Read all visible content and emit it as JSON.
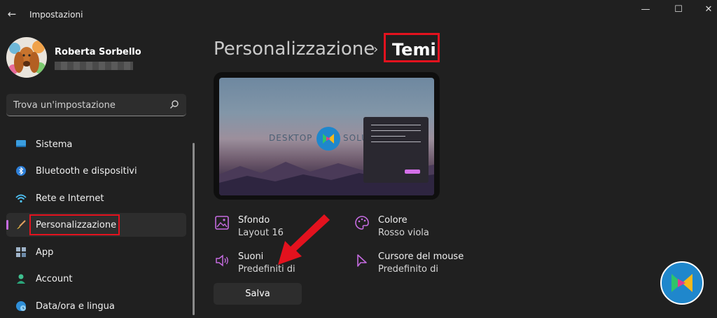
{
  "app": {
    "title": "Impostazioni"
  },
  "window_controls": {
    "minimize": "—",
    "maximize": "☐",
    "close": "✕"
  },
  "user": {
    "name": "Roberta Sorbello"
  },
  "search": {
    "placeholder": "Trova un'impostazione"
  },
  "sidebar": {
    "items": [
      {
        "label": "Sistema",
        "icon": "monitor-icon"
      },
      {
        "label": "Bluetooth e dispositivi",
        "icon": "bluetooth-icon"
      },
      {
        "label": "Rete e Internet",
        "icon": "wifi-icon"
      },
      {
        "label": "Personalizzazione",
        "icon": "brush-icon",
        "active": true
      },
      {
        "label": "App",
        "icon": "apps-icon"
      },
      {
        "label": "Account",
        "icon": "person-icon"
      },
      {
        "label": "Data/ora e lingua",
        "icon": "globe-clock-icon"
      }
    ]
  },
  "breadcrumb": {
    "parent": "Personalizzazione",
    "separator": "›",
    "current": "Temi"
  },
  "preview": {
    "logo_left": "DESKTOP",
    "logo_right": "SOLU"
  },
  "options": [
    {
      "title": "Sfondo",
      "value": "Layout 16",
      "icon": "image-icon"
    },
    {
      "title": "Colore",
      "value": "Rosso viola",
      "icon": "palette-icon"
    },
    {
      "title": "Suoni",
      "value": "Predefiniti di",
      "icon": "speaker-icon"
    },
    {
      "title": "Cursore del mouse",
      "value": "Predefinito di",
      "icon": "cursor-icon"
    }
  ],
  "actions": {
    "save": "Salva"
  },
  "colors": {
    "accent": "#c56be0",
    "highlight": "#e3121e",
    "background": "#202020",
    "card": "#2d2d2d"
  }
}
